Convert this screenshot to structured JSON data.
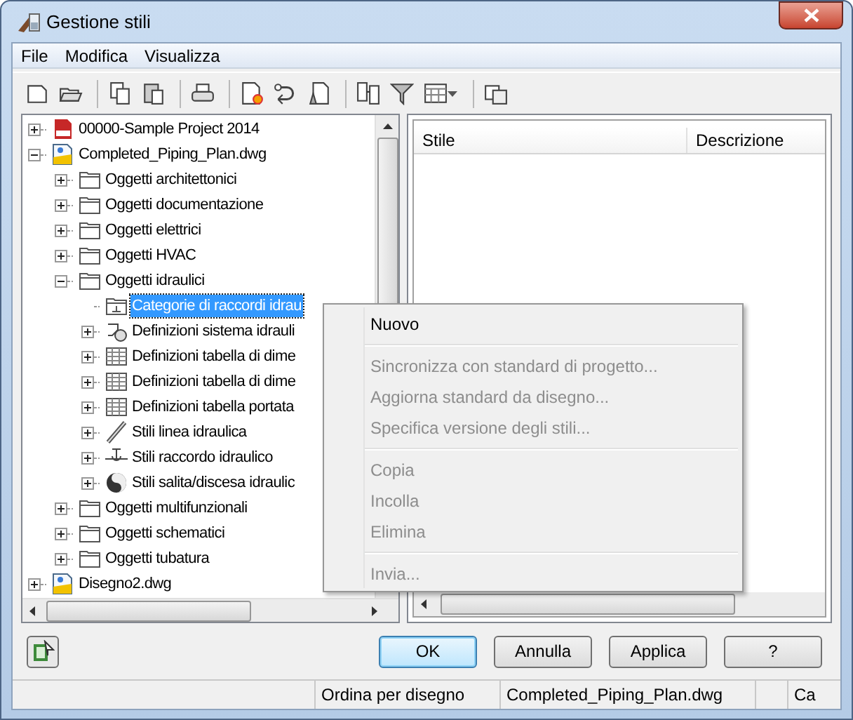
{
  "window": {
    "title": "Gestione stili"
  },
  "menu_bar": [
    {
      "label": "File"
    },
    {
      "label": "Modifica"
    },
    {
      "label": "Visualizza"
    }
  ],
  "tree": [
    {
      "label": "00000-Sample Project 2014",
      "kind": "project",
      "expanded": false,
      "selected": false
    },
    {
      "label": "Completed_Piping_Plan.dwg",
      "kind": "dwg",
      "expanded": true,
      "selected": false,
      "children": [
        {
          "label": "Oggetti architettonici",
          "kind": "folder",
          "expanded": false,
          "selected": false
        },
        {
          "label": "Oggetti documentazione",
          "kind": "folder",
          "expanded": false,
          "selected": false
        },
        {
          "label": "Oggetti elettrici",
          "kind": "folder",
          "expanded": false,
          "selected": false
        },
        {
          "label": "Oggetti HVAC",
          "kind": "folder",
          "expanded": false,
          "selected": false
        },
        {
          "label": "Oggetti idraulici",
          "kind": "folder",
          "expanded": true,
          "selected": false,
          "children": [
            {
              "label": "Categorie di raccordi idrau",
              "kind": "category",
              "selected": true
            },
            {
              "label": "Definizioni sistema idrauli",
              "kind": "system",
              "expanded": false,
              "selected": false
            },
            {
              "label": "Definizioni tabella di dime",
              "kind": "table",
              "expanded": false,
              "selected": false
            },
            {
              "label": "Definizioni tabella di dime",
              "kind": "table",
              "expanded": false,
              "selected": false
            },
            {
              "label": "Definizioni tabella portata",
              "kind": "table",
              "expanded": false,
              "selected": false
            },
            {
              "label": "Stili linea idraulica",
              "kind": "line",
              "expanded": false,
              "selected": false
            },
            {
              "label": "Stili raccordo idraulico",
              "kind": "fitting",
              "expanded": false,
              "selected": false
            },
            {
              "label": "Stili salita/discesa idraulic",
              "kind": "sphere",
              "expanded": false,
              "selected": false
            }
          ]
        },
        {
          "label": "Oggetti multifunzionali",
          "kind": "folder",
          "expanded": false,
          "selected": false
        },
        {
          "label": "Oggetti schematici",
          "kind": "folder",
          "expanded": false,
          "selected": false
        },
        {
          "label": "Oggetti tubatura",
          "kind": "folder",
          "expanded": false,
          "selected": false
        }
      ]
    },
    {
      "label": "Disegno2.dwg",
      "kind": "dwg",
      "expanded": false,
      "selected": false
    }
  ],
  "list": {
    "columns": [
      "Stile",
      "Descrizione"
    ]
  },
  "context_menu": [
    {
      "kind": "item",
      "label": "Nuovo",
      "disabled": false
    },
    {
      "kind": "separator"
    },
    {
      "kind": "item",
      "label": "Sincronizza con standard di progetto...",
      "disabled": true
    },
    {
      "kind": "item",
      "label": "Aggiorna standard da disegno...",
      "disabled": true
    },
    {
      "kind": "item",
      "label": "Specifica versione degli stili...",
      "disabled": true
    },
    {
      "kind": "separator"
    },
    {
      "kind": "item",
      "label": "Copia",
      "disabled": true
    },
    {
      "kind": "item",
      "label": "Incolla",
      "disabled": true
    },
    {
      "kind": "item",
      "label": "Elimina",
      "disabled": true
    },
    {
      "kind": "separator"
    },
    {
      "kind": "item",
      "label": "Invia...",
      "disabled": true
    }
  ],
  "buttons": [
    {
      "label": "OK",
      "default": true
    },
    {
      "label": "Annulla",
      "default": false
    },
    {
      "label": "Applica",
      "default": false
    },
    {
      "label": "?",
      "default": false
    }
  ],
  "status_bar": [
    "Ordina per disegno",
    "Completed_Piping_Plan.dwg",
    "Ca"
  ]
}
